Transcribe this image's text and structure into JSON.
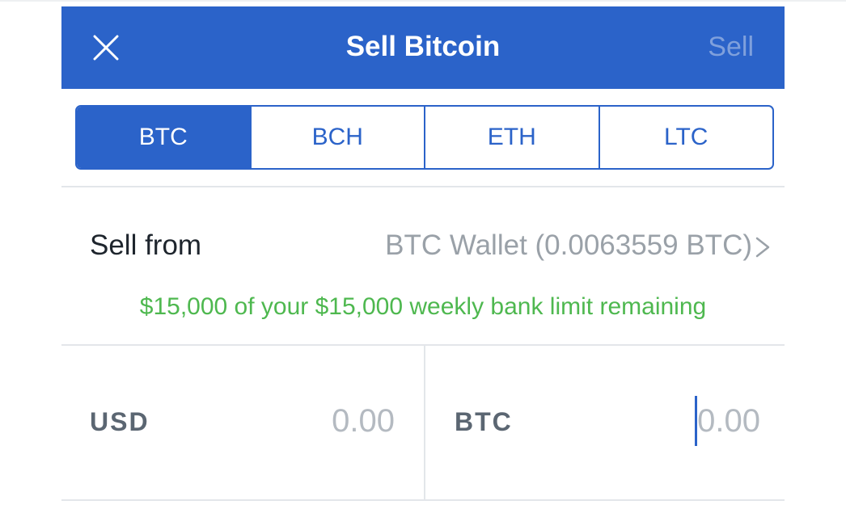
{
  "header": {
    "title": "Sell Bitcoin",
    "close_icon": "close-icon",
    "action_label": "Sell"
  },
  "currency_tabs": [
    {
      "label": "BTC",
      "selected": true
    },
    {
      "label": "BCH",
      "selected": false
    },
    {
      "label": "ETH",
      "selected": false
    },
    {
      "label": "LTC",
      "selected": false
    }
  ],
  "sell_from": {
    "label": "Sell from",
    "value": "BTC Wallet (0.0063559 BTC)",
    "chevron_icon": "chevron-right-icon"
  },
  "limit_notice": "$15,000 of your $15,000 weekly bank limit remaining",
  "amounts": {
    "usd": {
      "currency": "USD",
      "placeholder": "0.00"
    },
    "btc": {
      "currency": "BTC",
      "placeholder": "0.00"
    }
  },
  "colors": {
    "brand_blue": "#2b63c9",
    "limit_green": "#4eb84f",
    "muted_gray": "#9aa1a8"
  }
}
